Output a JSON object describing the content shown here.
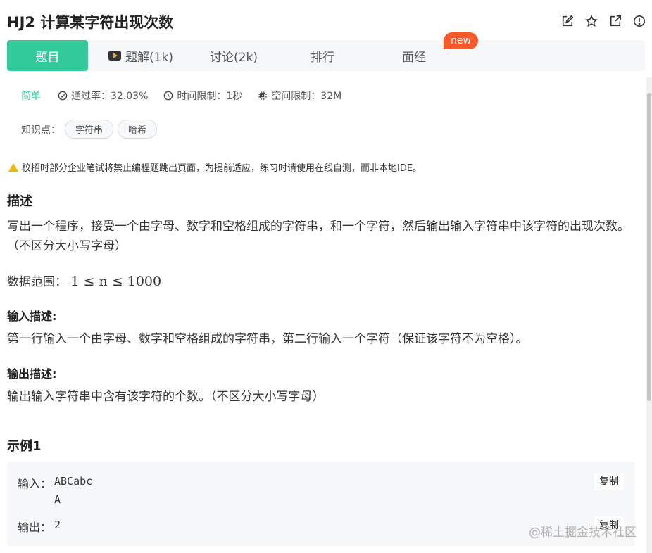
{
  "problem": {
    "title": "HJ2  计算某字符出现次数"
  },
  "tabs": [
    {
      "label": "题目"
    },
    {
      "label": "题解(1k)"
    },
    {
      "label": "讨论(2k)"
    },
    {
      "label": "排行"
    },
    {
      "label": "面经"
    }
  ],
  "new_badge": "new",
  "meta": {
    "level": "简单",
    "pass_rate": "通过率：32.03%",
    "time_limit": "时间限制：1秒",
    "space_limit": "空间限制：32M"
  },
  "knowledge": {
    "label": "知识点：",
    "tags": [
      "字符串",
      "哈希"
    ]
  },
  "warning": "校招时部分企业笔试将禁止编程题跳出页面，为提前适应，练习时请使用在线自测，而非本地IDE。",
  "description": {
    "heading": "描述",
    "text": "写出一个程序，接受一个由字母、数字和空格组成的字符串，和一个字符，然后输出输入字符串中该字符的出现次数。（不区分大小写字母）",
    "range_label": "数据范围：",
    "range_formula": "1 ≤ n ≤ 1000"
  },
  "input_desc": {
    "heading": "输入描述:",
    "text": "第一行输入一个由字母、数字和空格组成的字符串，第二行输入一个字符（保证该字符不为空格）。"
  },
  "output_desc": {
    "heading": "输出描述:",
    "text": "输出输入字符串中含有该字符的个数。（不区分大小写字母）"
  },
  "example": {
    "heading": "示例1",
    "input_label": "输入：",
    "input_value": "ABCabc\nA",
    "output_label": "输出：",
    "output_value": "2",
    "copy_label": "复制"
  },
  "watermark": "@稀土掘金技术社区",
  "icons": {
    "edit": "edit-icon",
    "star": "star-icon",
    "external": "external-link-icon",
    "info": "info-icon",
    "video": "video-icon",
    "check": "check-circle-icon",
    "clock": "clock-icon",
    "chip": "chip-icon",
    "warning": "warning-icon"
  },
  "colors": {
    "accent": "#32ca99",
    "badge": "#fa5a2a",
    "warning": "#f5b400"
  }
}
